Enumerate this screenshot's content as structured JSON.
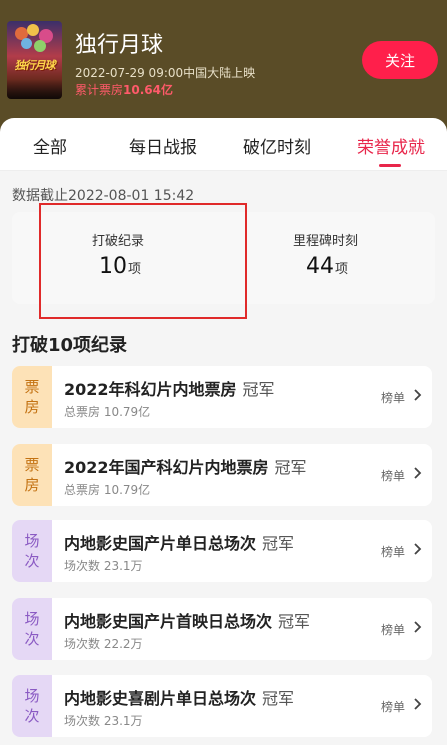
{
  "movie": {
    "poster_text": "独行月球",
    "title": "独行月球",
    "release": "2022-07-29 09:00中国大陆上映",
    "boxoffice_label": "累计票房",
    "boxoffice_value": "10.64亿",
    "follow_label": "关注"
  },
  "tabs": [
    {
      "label": "全部"
    },
    {
      "label": "每日战报"
    },
    {
      "label": "破亿时刻"
    },
    {
      "label": "荣誉成就",
      "active": true
    }
  ],
  "cutoff": "数据截止2022-08-01 15:42",
  "stats": {
    "records": {
      "label": "打破纪录",
      "value": "10",
      "unit": "项"
    },
    "milestones": {
      "label": "里程碑时刻",
      "value": "44",
      "unit": "项"
    }
  },
  "section_title": "打破10项纪录",
  "records": [
    {
      "tag": [
        "票",
        "房"
      ],
      "tag_type": "box",
      "title": "2022年科幻片内地票房",
      "badge": "冠军",
      "sub": "总票房 10.79亿",
      "link": "榜单"
    },
    {
      "tag": [
        "票",
        "房"
      ],
      "tag_type": "box",
      "title": "2022年国产科幻片内地票房",
      "badge": "冠军",
      "sub": "总票房 10.79亿",
      "link": "榜单"
    },
    {
      "tag": [
        "场",
        "次"
      ],
      "tag_type": "show",
      "title": "内地影史国产片单日总场次",
      "badge": "冠军",
      "sub": "场次数 23.1万",
      "link": "榜单"
    },
    {
      "tag": [
        "场",
        "次"
      ],
      "tag_type": "show",
      "title": "内地影史国产片首映日总场次",
      "badge": "冠军",
      "sub": "场次数 22.2万",
      "link": "榜单"
    },
    {
      "tag": [
        "场",
        "次"
      ],
      "tag_type": "show",
      "title": "内地影史喜剧片单日总场次",
      "badge": "冠军",
      "sub": "场次数 23.1万",
      "link": "榜单"
    }
  ],
  "colors": {
    "header_bg": "#5a4c27",
    "accent": "#e8264b",
    "follow_bg": "#ff1f4b",
    "box_tag_bg": "#fde2b7",
    "show_tag_bg": "#e5d8f5"
  }
}
